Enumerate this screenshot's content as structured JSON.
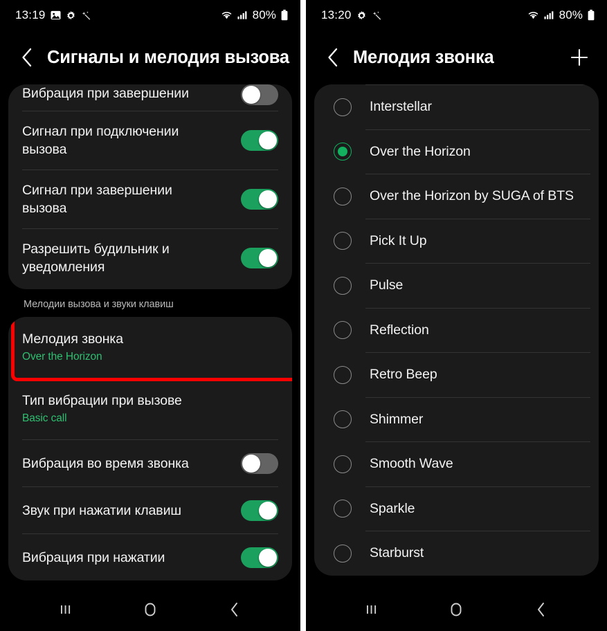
{
  "left_screen": {
    "status_bar": {
      "time": "13:19",
      "battery_text": "80%",
      "left_icons": [
        "image-icon",
        "gear-icon",
        "magic-wand-icon"
      ],
      "right_icons": [
        "wifi-icon",
        "signal-icon",
        "battery-icon"
      ]
    },
    "app_bar": {
      "back_icon": "chevron-left-icon",
      "title": "Сигналы и мелодия вызова"
    },
    "card_top_items": [
      {
        "title": "Вибрация при завершении",
        "toggle": "off",
        "clipped": true
      },
      {
        "title": "Сигнал при подключении вызова",
        "toggle": "on"
      },
      {
        "title": "Сигнал при завершении вызова",
        "toggle": "on"
      },
      {
        "title": "Разрешить будильник и уведомления",
        "toggle": "on"
      }
    ],
    "section_header": "Мелодии вызова и звуки клавиш",
    "card_bottom_items": [
      {
        "title": "Мелодия звонка",
        "subtitle": "Over the Horizon",
        "highlighted": true
      },
      {
        "title": "Тип вибрации при вызове",
        "subtitle": "Basic call"
      },
      {
        "title": "Вибрация во время звонка",
        "toggle": "off"
      },
      {
        "title": "Звук при нажатии клавиш",
        "toggle": "on"
      },
      {
        "title": "Вибрация при нажатии",
        "toggle": "on"
      }
    ],
    "nav_bar": [
      "recents-icon",
      "home-icon",
      "back-icon"
    ]
  },
  "right_screen": {
    "status_bar": {
      "time": "13:20",
      "battery_text": "80%",
      "left_icons": [
        "gear-icon",
        "magic-wand-icon"
      ],
      "right_icons": [
        "wifi-icon",
        "signal-icon",
        "battery-icon"
      ]
    },
    "app_bar": {
      "back_icon": "chevron-left-icon",
      "title": "Мелодия звонка",
      "add_icon": "plus-icon"
    },
    "ringtones": [
      {
        "label": "Interstellar",
        "selected": false
      },
      {
        "label": "Over the Horizon",
        "selected": true
      },
      {
        "label": "Over the Horizon by SUGA of BTS",
        "selected": false
      },
      {
        "label": "Pick It Up",
        "selected": false
      },
      {
        "label": "Pulse",
        "selected": false
      },
      {
        "label": "Reflection",
        "selected": false
      },
      {
        "label": "Retro Beep",
        "selected": false
      },
      {
        "label": "Shimmer",
        "selected": false
      },
      {
        "label": "Smooth Wave",
        "selected": false
      },
      {
        "label": "Sparkle",
        "selected": false
      },
      {
        "label": "Starburst",
        "selected": false
      }
    ],
    "nav_bar": [
      "recents-icon",
      "home-icon",
      "back-icon"
    ]
  },
  "colors": {
    "accent_green": "#1ba05e",
    "subtitle_green": "#2fbf71",
    "highlight_red": "#ff0000",
    "card_bg": "#1b1b1b",
    "page_bg": "#000000"
  }
}
